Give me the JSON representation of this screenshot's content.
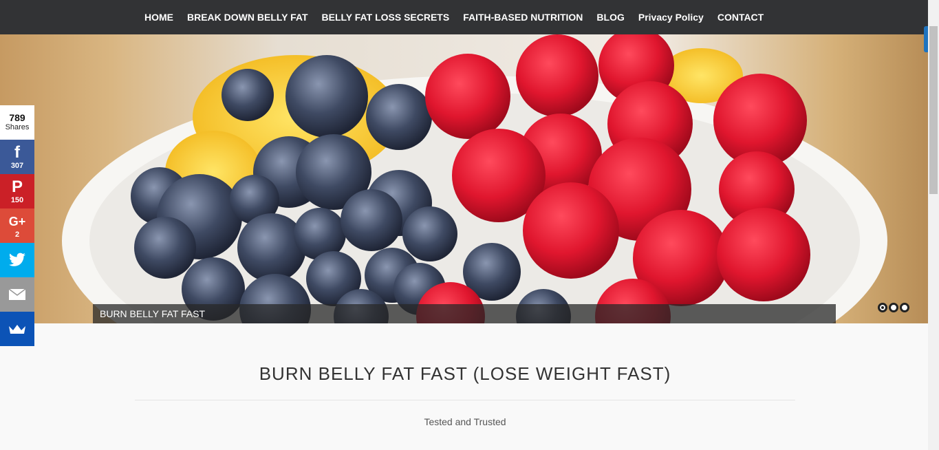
{
  "nav": {
    "items": [
      {
        "label": "HOME"
      },
      {
        "label": "BREAK DOWN BELLY FAT"
      },
      {
        "label": "BELLY FAT LOSS SECRETS"
      },
      {
        "label": "FAITH-BASED NUTRITION"
      },
      {
        "label": "BLOG"
      },
      {
        "label": "Privacy Policy"
      },
      {
        "label": "CONTACT"
      }
    ]
  },
  "hero": {
    "caption": "BURN BELLY FAT FAST",
    "slide_count": 3,
    "active_slide": 1
  },
  "share": {
    "total": "789",
    "total_label": "Shares",
    "facebook": {
      "icon": "f",
      "count": "307"
    },
    "pinterest": {
      "icon": "P",
      "count": "150"
    },
    "googleplus": {
      "icon": "G+",
      "count": "2"
    },
    "twitter": {
      "icon": "twitter-bird"
    },
    "email": {
      "icon": "envelope"
    },
    "sumome": {
      "icon": "crown"
    }
  },
  "main": {
    "title": "BURN BELLY FAT FAST (LOSE WEIGHT FAST)",
    "tagline": "Tested and Trusted"
  },
  "colors": {
    "nav_bg": "#323335",
    "facebook": "#3b5998",
    "pinterest": "#cb2027",
    "googleplus": "#dd4b39",
    "twitter": "#00aced",
    "email": "#999999",
    "sumome": "#0c53b6"
  }
}
